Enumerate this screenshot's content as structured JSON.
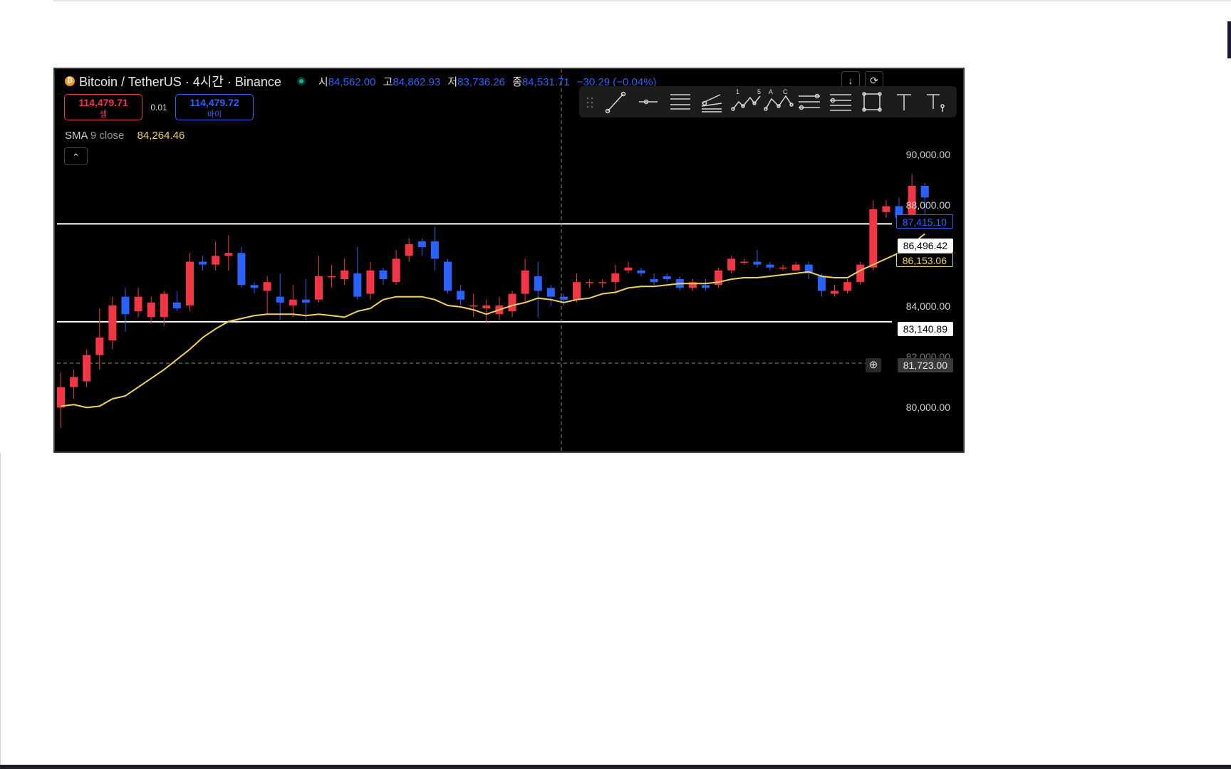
{
  "window": {
    "symbol": "Bitcoin / TetherUS · 4시간 · Binance",
    "coin_icon": "bitcoin-icon",
    "ohlc": {
      "open_label": "시",
      "open": "84,562.00",
      "high_label": "고",
      "high": "84,862.93",
      "low_label": "저",
      "low": "83,736.26",
      "close_label": "종",
      "close": "84,531.71",
      "change": "−30.29 (−0.04%)"
    }
  },
  "trade": {
    "sell_price": "114,479.71",
    "sell_label": "셀",
    "spread": "0.01",
    "buy_price": "114,479.72",
    "buy_label": "바이"
  },
  "indicator": {
    "name": "SMA",
    "params": "9 close",
    "value": "84,264.46"
  },
  "header_buttons": {
    "download_icon": "↓",
    "refresh_icon": "⟳"
  },
  "collapse_icon": "⌃",
  "toolbar": {
    "tools": [
      "drag-handle-icon",
      "trendline-icon",
      "horizontal-ray-icon",
      "parallel-channel-icon",
      "pitchfork-icon",
      "elliott-wave-icon",
      "abcd-pattern-icon",
      "fib-retracement-icon",
      "fib-extension-icon",
      "rectangle-icon",
      "text-icon",
      "anchored-text-icon"
    ],
    "wave_label_1": "1",
    "wave_label_5": "5",
    "abcd_a": "A",
    "abcd_c": "C"
  },
  "price_axis": [
    "90,000.00",
    "88,000.00",
    "84,000.00",
    "82,000.00",
    "80,000.00"
  ],
  "price_tags": {
    "last_price": "87,415.10",
    "level_high": "86,496.42",
    "sma_value": "86,153.06",
    "level_low": "83,140.89",
    "crosshair": "81,723.00"
  },
  "colors": {
    "up": "#f23645",
    "down": "#2962ff",
    "sma": "#f0d060",
    "background": "#000000",
    "level": "#ffffff"
  },
  "chart_data": {
    "type": "candlestick",
    "y_range": [
      78600,
      91800
    ],
    "horizontal_levels": [
      86496.42,
      83140.89
    ],
    "crosshair_price": 81723.0,
    "candles": [
      [
        80200,
        80900,
        79500,
        81400
      ],
      [
        80900,
        81250,
        80500,
        81500
      ],
      [
        81100,
        82000,
        80900,
        82200
      ],
      [
        82000,
        82600,
        81500,
        83600
      ],
      [
        82500,
        83700,
        82200,
        84000
      ],
      [
        84000,
        83400,
        82800,
        84300
      ],
      [
        83500,
        84000,
        83300,
        84300
      ],
      [
        83300,
        83800,
        83100,
        84000
      ],
      [
        83300,
        84100,
        83000,
        84200
      ],
      [
        83800,
        83600,
        83500,
        84200
      ],
      [
        83700,
        85200,
        83500,
        85500
      ],
      [
        85200,
        85100,
        84900,
        85400
      ],
      [
        85100,
        85400,
        84900,
        85900
      ],
      [
        85400,
        85500,
        84900,
        86100
      ],
      [
        85500,
        84400,
        84300,
        85700
      ],
      [
        84400,
        84300,
        84100,
        84500
      ],
      [
        84200,
        84500,
        83400,
        84700
      ],
      [
        84000,
        83800,
        83200,
        84800
      ],
      [
        83700,
        83900,
        83300,
        84400
      ],
      [
        83900,
        83800,
        83200,
        84600
      ],
      [
        83900,
        84700,
        83800,
        85400
      ],
      [
        84700,
        84700,
        84300,
        85100
      ],
      [
        84600,
        84900,
        84400,
        85300
      ],
      [
        84800,
        84000,
        83900,
        85700
      ],
      [
        84100,
        84900,
        83900,
        85200
      ],
      [
        84900,
        84600,
        84400,
        85000
      ],
      [
        84500,
        85300,
        84400,
        85600
      ],
      [
        85400,
        85800,
        85200,
        86000
      ],
      [
        85900,
        85700,
        85400,
        86000
      ],
      [
        85900,
        85300,
        84900,
        86400
      ],
      [
        85200,
        84200,
        84100,
        85300
      ],
      [
        84200,
        83900,
        83700,
        84400
      ],
      [
        83700,
        83700,
        83300,
        84100
      ],
      [
        83600,
        83700,
        83100,
        83900
      ],
      [
        83400,
        83700,
        83200,
        84000
      ],
      [
        83500,
        84100,
        83300,
        84200
      ],
      [
        84100,
        84900,
        83800,
        85300
      ],
      [
        84700,
        84200,
        83300,
        85200
      ],
      [
        84300,
        84000,
        83700,
        84400
      ],
      [
        84000,
        83900,
        83700,
        84100
      ],
      [
        83900,
        84500,
        83800,
        84800
      ],
      [
        84500,
        84500,
        84300,
        84600
      ],
      [
        84500,
        84500,
        84300,
        84600
      ],
      [
        84500,
        84800,
        84200,
        85100
      ],
      [
        84900,
        85000,
        84800,
        85200
      ],
      [
        84900,
        84800,
        84700,
        85000
      ],
      [
        84600,
        84500,
        84400,
        84800
      ],
      [
        84700,
        84600,
        84500,
        84800
      ],
      [
        84600,
        84300,
        84200,
        84700
      ],
      [
        84300,
        84500,
        84200,
        84600
      ],
      [
        84400,
        84300,
        84200,
        84600
      ],
      [
        84400,
        84900,
        84300,
        85000
      ],
      [
        84900,
        85300,
        84800,
        85400
      ],
      [
        85200,
        85200,
        85100,
        85300
      ],
      [
        85200,
        85100,
        85000,
        85600
      ],
      [
        85100,
        85000,
        84900,
        85200
      ],
      [
        85000,
        85000,
        84900,
        85100
      ],
      [
        84900,
        85100,
        84900,
        85200
      ],
      [
        85100,
        84800,
        84600,
        85200
      ],
      [
        84700,
        84200,
        84000,
        84800
      ],
      [
        84100,
        84200,
        84000,
        84400
      ],
      [
        84200,
        84500,
        84100,
        84600
      ],
      [
        84500,
        85100,
        84400,
        85200
      ],
      [
        85000,
        87000,
        84900,
        87300
      ],
      [
        86900,
        87100,
        86700,
        87300
      ],
      [
        87100,
        86700,
        86500,
        87400
      ],
      [
        86800,
        87800,
        86600,
        88200
      ],
      [
        87800,
        87400,
        86700,
        87900
      ]
    ],
    "sma": [
      80250,
      80300,
      80200,
      80250,
      80500,
      80600,
      80900,
      81200,
      81500,
      81850,
      82200,
      82600,
      82900,
      83150,
      83250,
      83350,
      83400,
      83400,
      83400,
      83350,
      83400,
      83350,
      83300,
      83500,
      83600,
      83900,
      84000,
      84000,
      84000,
      83900,
      83700,
      83650,
      83550,
      83400,
      83550,
      83700,
      83800,
      83950,
      83900,
      83800,
      83900,
      83950,
      84100,
      84150,
      84300,
      84350,
      84350,
      84400,
      84450,
      84450,
      84450,
      84500,
      84600,
      84650,
      84650,
      84700,
      84750,
      84800,
      84850,
      84700,
      84650,
      84650,
      84900,
      85100,
      85300,
      85500,
      85800,
      86153.06
    ]
  }
}
